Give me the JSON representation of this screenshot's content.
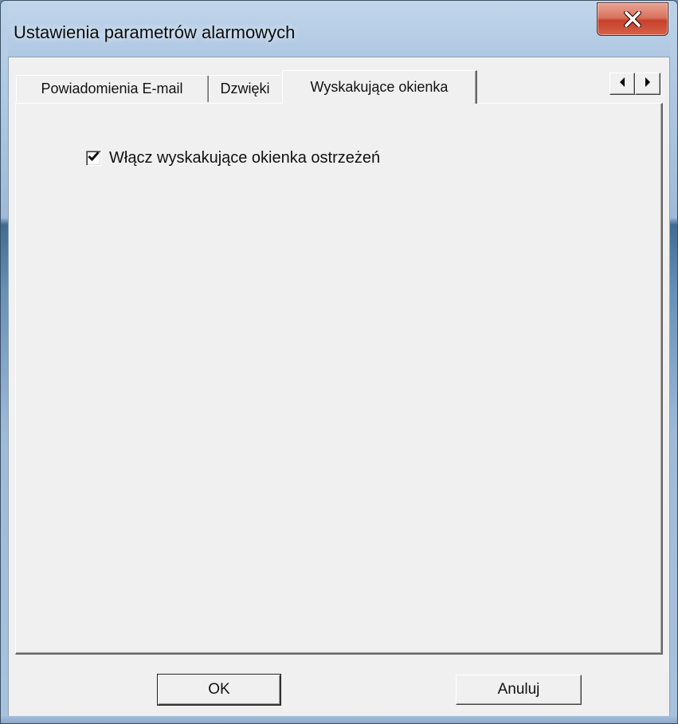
{
  "window": {
    "title": "Ustawienia parametrów alarmowych"
  },
  "tabs": [
    {
      "label": "Powiadomienia E-mail",
      "active": false
    },
    {
      "label": "Dzwięki",
      "active": false
    },
    {
      "label": "Wyskakujące okienka",
      "active": true
    }
  ],
  "popup_panel": {
    "enable_checkbox": {
      "label": "Włącz wyskakujące okienka ostrzeżeń",
      "checked": true
    }
  },
  "buttons": {
    "ok_label": "OK",
    "cancel_label": "Anuluj"
  },
  "icons": {
    "close": "close-icon",
    "scroll_left": "arrow-left-icon",
    "scroll_right": "arrow-right-icon",
    "check": "checkmark-icon"
  },
  "colors": {
    "dialog_face": "#f0f0f0",
    "close_button": "#c7402a",
    "frame": "#a3bedc"
  }
}
